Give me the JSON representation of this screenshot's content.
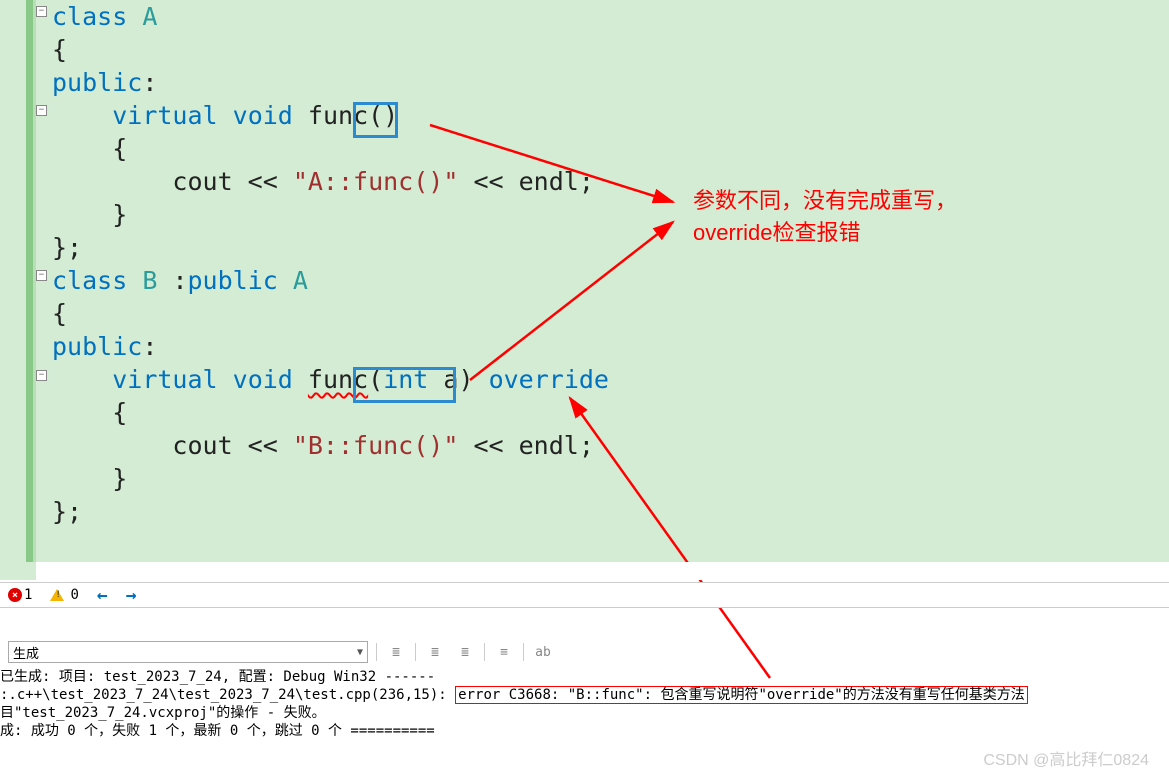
{
  "code": {
    "lines": [
      [
        {
          "c": "kw",
          "t": "class"
        },
        {
          "c": "plain",
          "t": " "
        },
        {
          "c": "nm",
          "t": "A"
        }
      ],
      [
        {
          "c": "plain",
          "t": "{"
        }
      ],
      [
        {
          "c": "kw",
          "t": "public"
        },
        {
          "c": "plain",
          "t": ":"
        }
      ],
      [
        {
          "c": "plain",
          "t": "    "
        },
        {
          "c": "kw",
          "t": "virtual"
        },
        {
          "c": "plain",
          "t": " "
        },
        {
          "c": "kw",
          "t": "void"
        },
        {
          "c": "plain",
          "t": " "
        },
        {
          "c": "plain",
          "t": "func()"
        }
      ],
      [
        {
          "c": "plain",
          "t": "    {"
        }
      ],
      [
        {
          "c": "plain",
          "t": "        cout << "
        },
        {
          "c": "str",
          "t": "\"A::func()\""
        },
        {
          "c": "plain",
          "t": " << endl;"
        }
      ],
      [
        {
          "c": "plain",
          "t": "    }"
        }
      ],
      [
        {
          "c": "plain",
          "t": "};"
        }
      ],
      [
        {
          "c": "kw",
          "t": "class"
        },
        {
          "c": "plain",
          "t": " "
        },
        {
          "c": "nm",
          "t": "B"
        },
        {
          "c": "plain",
          "t": " :"
        },
        {
          "c": "kw",
          "t": "public"
        },
        {
          "c": "plain",
          "t": " "
        },
        {
          "c": "nm",
          "t": "A"
        }
      ],
      [
        {
          "c": "plain",
          "t": "{"
        }
      ],
      [
        {
          "c": "kw",
          "t": "public"
        },
        {
          "c": "plain",
          "t": ":"
        }
      ],
      [
        {
          "c": "plain",
          "t": "    "
        },
        {
          "c": "kw",
          "t": "virtual"
        },
        {
          "c": "plain",
          "t": " "
        },
        {
          "c": "kw",
          "t": "void"
        },
        {
          "c": "plain",
          "t": " "
        },
        {
          "c": "plain squiggle",
          "t": "func"
        },
        {
          "c": "plain",
          "t": "("
        },
        {
          "c": "kw",
          "t": "int"
        },
        {
          "c": "plain",
          "t": " a) "
        },
        {
          "c": "kw",
          "t": "override"
        }
      ],
      [
        {
          "c": "plain",
          "t": "    {"
        }
      ],
      [
        {
          "c": "plain",
          "t": "        cout << "
        },
        {
          "c": "str",
          "t": "\"B::func()\""
        },
        {
          "c": "plain",
          "t": " << endl;"
        }
      ],
      [
        {
          "c": "plain",
          "t": "    }"
        }
      ],
      [
        {
          "c": "plain",
          "t": "};"
        }
      ]
    ]
  },
  "annotation": {
    "line1": "参数不同，没有完成重写，",
    "line2": "override检查报错"
  },
  "status": {
    "errors": "1",
    "warnings": "0"
  },
  "output": {
    "combo": "生成",
    "line1": "已生成: 项目: test_2023_7_24, 配置: Debug Win32 ------",
    "line2_path": ":.c++\\test_2023_7_24\\test_2023_7_24\\test.cpp(236,15): ",
    "line2_error": "error C3668: \"B::func\": 包含重写说明符\"override\"的方法没有重写任何基类方法",
    "line3": "目\"test_2023_7_24.vcxproj\"的操作 - 失败。",
    "line4": "成: 成功 0 个，失败 1 个，最新 0 个，跳过 0 个 =========="
  },
  "watermark": "CSDN @高比拜仁0824"
}
